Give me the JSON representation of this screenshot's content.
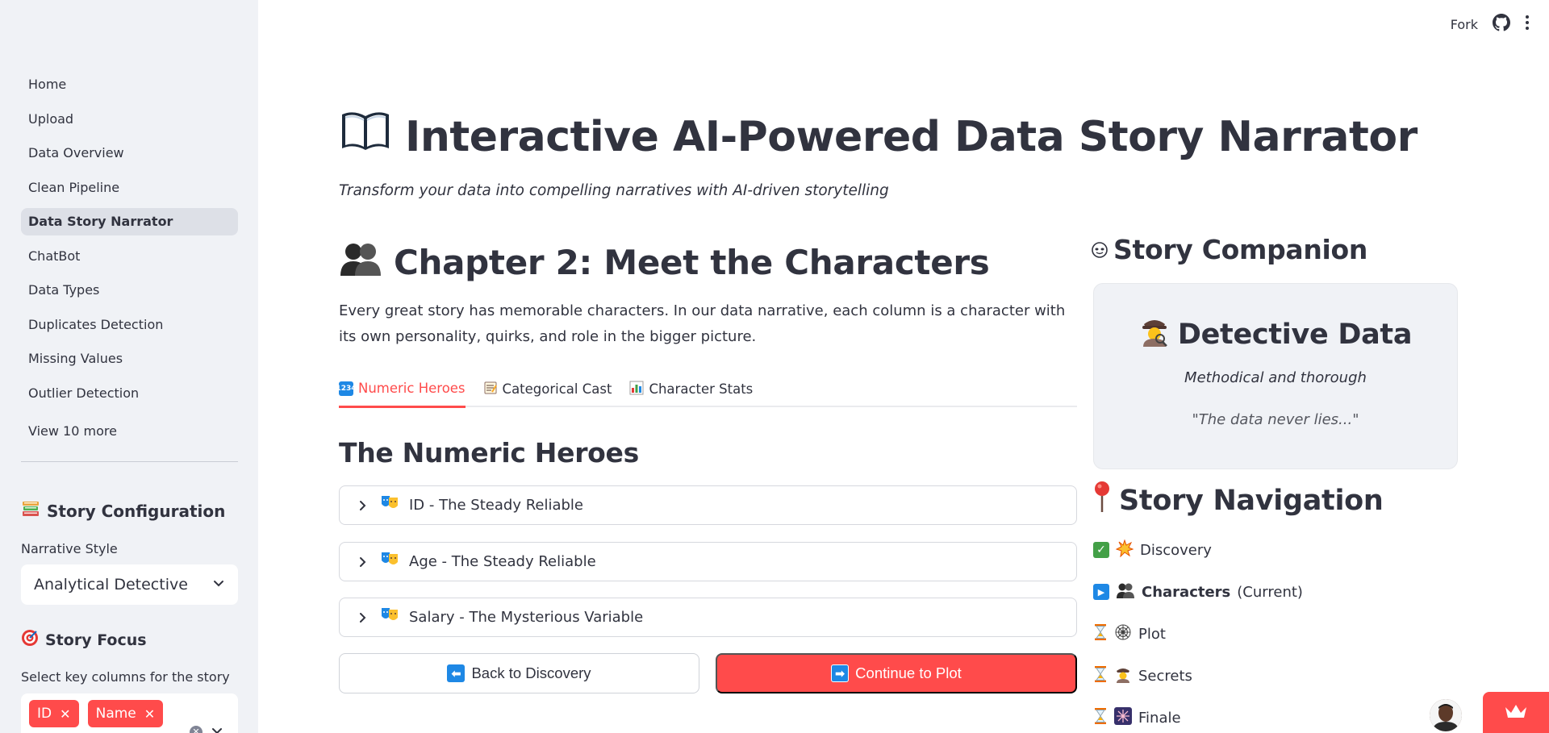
{
  "sidebar": {
    "nav_items": [
      {
        "label": "Home"
      },
      {
        "label": "Upload"
      },
      {
        "label": "Data Overview"
      },
      {
        "label": "Clean Pipeline"
      },
      {
        "label": "Data Story Narrator",
        "active": true
      },
      {
        "label": "ChatBot"
      },
      {
        "label": "Data Types"
      },
      {
        "label": "Duplicates Detection"
      },
      {
        "label": "Missing Values"
      },
      {
        "label": "Outlier Detection"
      }
    ],
    "view_more": "View 10 more",
    "story_config": {
      "heading": "Story Configuration",
      "narrative_label": "Narrative Style",
      "narrative_value": "Analytical Detective"
    },
    "story_focus": {
      "heading": "Story Focus",
      "columns_label": "Select key columns for the story",
      "selected": [
        "ID",
        "Name"
      ]
    }
  },
  "header": {
    "fork_label": "Fork"
  },
  "main": {
    "title": "Interactive AI-Powered Data Story Narrator",
    "subtitle": "Transform your data into compelling narratives with AI-driven storytelling",
    "chapter_title": "Chapter 2: Meet the Characters",
    "intro": "Every great story has memorable characters. In our data narrative, each column is a character with its own personality, quirks, and role in the bigger picture.",
    "tabs": [
      {
        "label": "Numeric Heroes",
        "active": true
      },
      {
        "label": "Categorical Cast"
      },
      {
        "label": "Character Stats"
      }
    ],
    "section_heading": "The Numeric Heroes",
    "expanders": [
      {
        "label": "ID - The Steady Reliable"
      },
      {
        "label": "Age - The Steady Reliable"
      },
      {
        "label": "Salary - The Mysterious Variable"
      }
    ],
    "back_button": "Back to Discovery",
    "continue_button": "Continue to Plot"
  },
  "companion": {
    "heading": "Story Companion",
    "name": "Detective Data",
    "trait": "Methodical and thorough",
    "quote": "\"The data never lies...\""
  },
  "story_navigation": {
    "heading": "Story Navigation",
    "steps": [
      {
        "status": "done",
        "label": "Discovery"
      },
      {
        "status": "current",
        "label": "Characters",
        "suffix": "(Current)"
      },
      {
        "status": "pending",
        "label": "Plot"
      },
      {
        "status": "pending",
        "label": "Secrets"
      },
      {
        "status": "pending",
        "label": "Finale"
      }
    ]
  },
  "colors": {
    "accent": "#ff4b4b",
    "sidebar_bg": "#f0f2f6",
    "text": "#31333f"
  }
}
